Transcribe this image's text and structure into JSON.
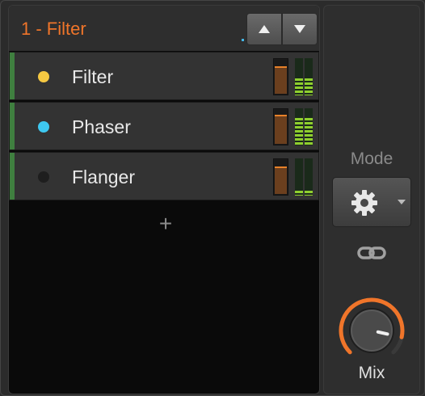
{
  "header": {
    "preset_name": "1 - Filter"
  },
  "chain": {
    "items": [
      {
        "label": "Filter",
        "dot_color": "#f5c842",
        "level": 0.8,
        "green_left": 0.45,
        "green_right": 0.45
      },
      {
        "label": "Phaser",
        "dot_color": "#3ec8f0",
        "level": 0.85,
        "green_left": 0.75,
        "green_right": 0.75
      },
      {
        "label": "Flanger",
        "dot_color": "#1e1e1e",
        "level": 0.8,
        "green_left": 0.12,
        "green_right": 0.12
      }
    ]
  },
  "controls": {
    "mode_label": "Mode",
    "mix_label": "Mix",
    "mix_value": 0.88
  },
  "colors": {
    "accent": "#f0752a",
    "track_accent": "#3f7f3f"
  }
}
